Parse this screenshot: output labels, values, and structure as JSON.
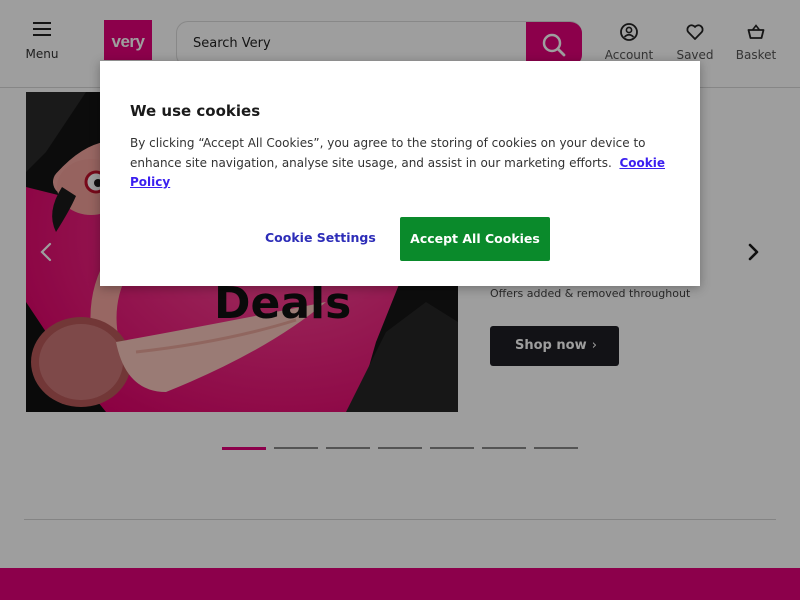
{
  "header": {
    "menu_label": "Menu",
    "logo_text": "very",
    "search_placeholder": "Search Very",
    "nav": {
      "account": "Account",
      "saved": "Saved",
      "basket": "Basket"
    }
  },
  "hero": {
    "image_caption": "Deals",
    "subtext": "Offers added & removed throughout",
    "cta_label": "Shop now",
    "slide_count": 7,
    "active_slide": 1
  },
  "cookie_dialog": {
    "title": "We use cookies",
    "body": "By clicking “Accept All Cookies”, you agree to the storing of cookies on your device to enhance site navigation, analyse site usage, and assist in our marketing efforts.",
    "policy_link": "Cookie Policy",
    "settings_label": "Cookie Settings",
    "accept_label": "Accept All Cookies"
  },
  "colors": {
    "brand": "#e2007a",
    "accept": "#0a8a2b",
    "link": "#3b1ff0",
    "dark_button": "#1e1e24"
  },
  "icons": {
    "menu": "hamburger-icon",
    "search": "search-icon",
    "account": "account-icon",
    "saved": "heart-icon",
    "basket": "basket-icon",
    "next": "chevron-right-icon",
    "prev": "chevron-left-icon"
  }
}
